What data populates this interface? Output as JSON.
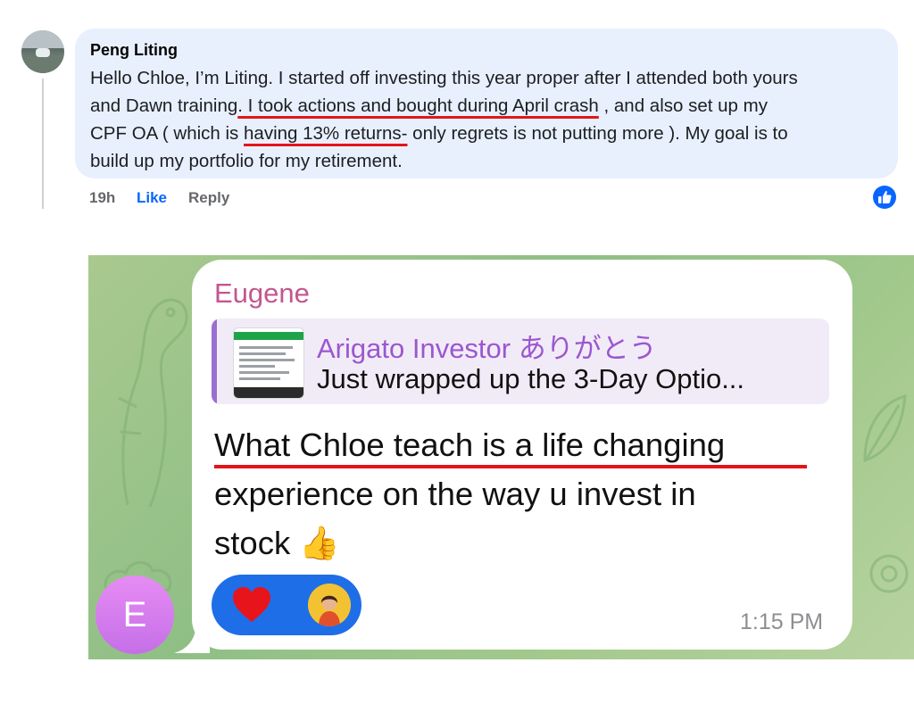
{
  "facebook_comment": {
    "author": "Peng Liting",
    "lines": [
      [
        "Hello Chloe, I’m Liting. I started off investing this year proper after I attended both yours",
        "",
        ""
      ],
      [
        "and Dawn training",
        ". I took actions and bought during April crash",
        " , and also set up my"
      ],
      [
        "CPF OA ( which is ",
        "having 13% returns-",
        " only regrets is not putting more ). My goal is to"
      ],
      [
        "build up my portfolio for my retirement.",
        "",
        ""
      ]
    ],
    "actions": {
      "time": "19h",
      "like": "Like",
      "reply": "Reply"
    },
    "reaction_icon": "thumbs-up-icon",
    "highlight_color": "#e4141b"
  },
  "telegram_message": {
    "sender": "Eugene",
    "sender_avatar_letter": "E",
    "reply_preview": {
      "title": "Arigato Investor ありがとう",
      "text": "Just wrapped up the 3-Day Optio..."
    },
    "message_lines": [
      "What Chloe teach is a life changing",
      "experience on the way u invest in",
      "stock 👍"
    ],
    "reactions": [
      "heart",
      "profile-avatar"
    ],
    "time": "1:15 PM",
    "colors": {
      "sender": "#c2578f",
      "reply_title": "#9b57cf",
      "reaction_pill": "#1e6ee8"
    }
  }
}
